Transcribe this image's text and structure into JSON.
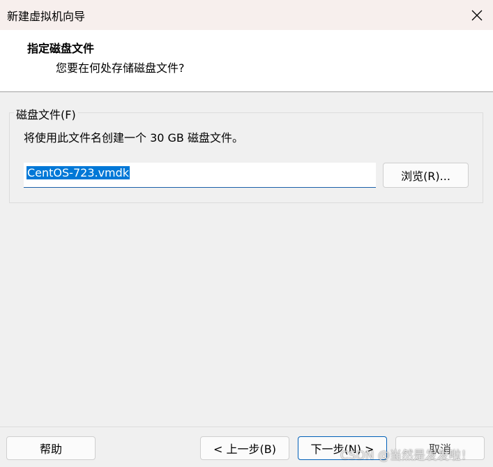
{
  "window": {
    "title": "新建虚拟机向导",
    "close_icon": "close-icon"
  },
  "header": {
    "title": "指定磁盘文件",
    "subtitle": "您要在何处存储磁盘文件?"
  },
  "disk_file_group": {
    "legend": "磁盘文件(F)",
    "description": "将使用此文件名创建一个 30 GB 磁盘文件。",
    "filename_value": "CentOS-723.vmdk",
    "browse_label": "浏览(R)..."
  },
  "footer": {
    "help_label": "帮助",
    "back_label": "< 上一步(B)",
    "next_label": "下一步(N) >",
    "cancel_label": "取消"
  },
  "watermark": "CSDN @当然是发发啦！",
  "colors": {
    "titlebar_bg": "#f7efed",
    "selection": "#0078d7",
    "accent_border": "#005fb8"
  }
}
